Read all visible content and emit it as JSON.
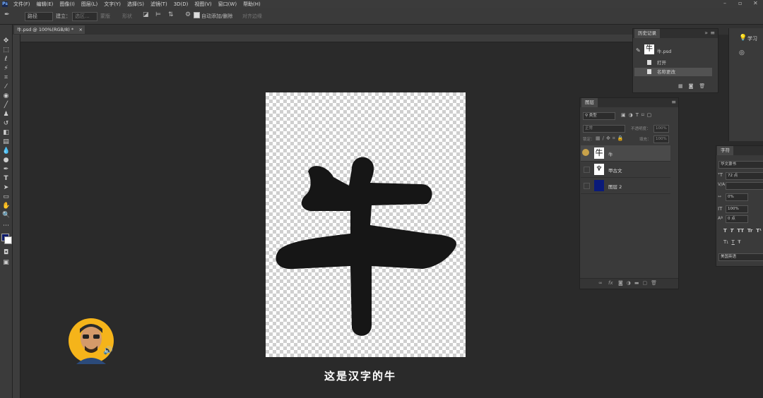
{
  "app": {
    "logo": "Ps"
  },
  "menu": [
    "文件(F)",
    "编辑(E)",
    "图像(I)",
    "图层(L)",
    "文字(Y)",
    "选择(S)",
    "滤镜(T)",
    "3D(D)",
    "视图(V)",
    "窗口(W)",
    "帮助(H)"
  ],
  "window_controls": {
    "minimize": "–",
    "maximize": "▫",
    "close": "✕"
  },
  "options": {
    "mode": "路径",
    "make": "建立：",
    "selection": "选区...",
    "mask": "蒙版",
    "shape": "形状",
    "auto_add": "自动添加/删除",
    "align_edges": "对齐边缘"
  },
  "document_tab": {
    "title": "牛.psd @ 100%(RGB/8) *",
    "close": "×"
  },
  "canvas": {
    "glyph": "牛"
  },
  "caption": "这是汉字的牛",
  "history": {
    "tab": "历史记录",
    "snapshot": "牛.psd",
    "items": [
      "打开",
      "名称更改"
    ]
  },
  "layers": {
    "tab": "图层",
    "filter": "类型",
    "blend": "正常",
    "opacity_label": "不透明度：",
    "opacity": "100%",
    "lock_label": "锁定：",
    "fill_label": "填充：",
    "fill": "100%",
    "rows": [
      {
        "name": "牛"
      },
      {
        "name": "甲古文"
      },
      {
        "name": "图层 2"
      }
    ],
    "fx_label": "fx"
  },
  "learn": {
    "label": "学习"
  },
  "character": {
    "tab": "字符",
    "font": "华文隶书",
    "size": "72 点",
    "kerning": "",
    "tracking": "0%",
    "vscale": "100%",
    "baseline": "0 点",
    "styles": [
      "T",
      "T",
      "TT",
      "Tr",
      "T¹",
      "T₁",
      "T",
      "Ŧ"
    ],
    "language": "美国英语"
  },
  "colors": {
    "fg": "#0d1a6b",
    "bg": "#ffffff",
    "layer2": "#0a1a7a",
    "glyph": "#161616",
    "accent": "#c8a24a"
  }
}
